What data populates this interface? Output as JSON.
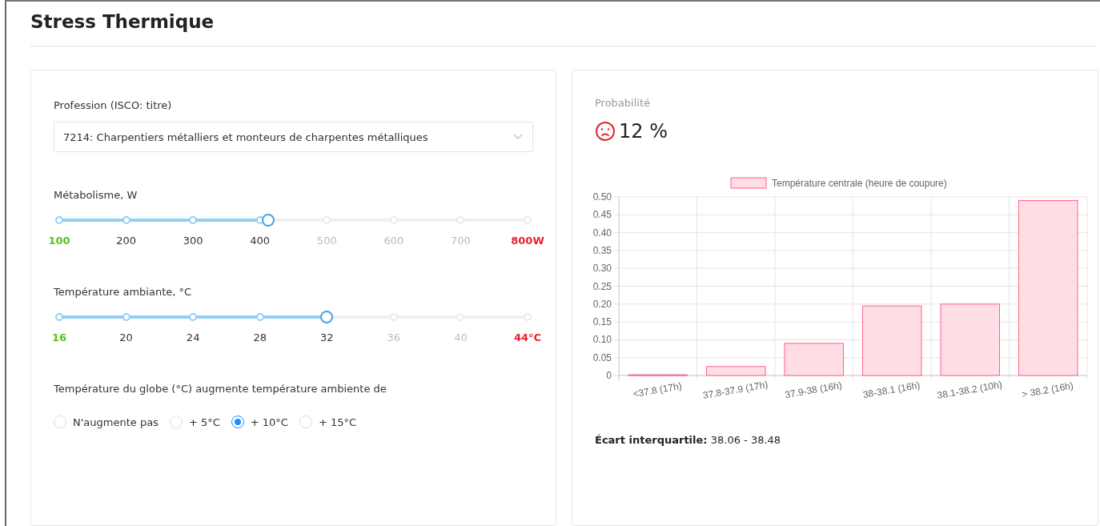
{
  "page": {
    "title": "Stress Thermique"
  },
  "form": {
    "profession": {
      "label": "Profession (ISCO: titre)",
      "value": "7214: Charpentiers métalliers et monteurs de charpentes métalliques"
    },
    "sliders": [
      {
        "label": "Métabolisme, W",
        "level": 0.446,
        "ticks": [
          {
            "label": "100",
            "kind": "min"
          },
          {
            "label": "200",
            "kind": "mid"
          },
          {
            "label": "300",
            "kind": "mid"
          },
          {
            "label": "400",
            "kind": "mid"
          },
          {
            "label": "500",
            "kind": "mid"
          },
          {
            "label": "600",
            "kind": "mid"
          },
          {
            "label": "700",
            "kind": "mid"
          },
          {
            "label": "800W",
            "kind": "max"
          }
        ]
      },
      {
        "label": "Température ambiante, °C",
        "level": 0.571,
        "ticks": [
          {
            "label": "16",
            "kind": "min"
          },
          {
            "label": "20",
            "kind": "mid"
          },
          {
            "label": "24",
            "kind": "mid"
          },
          {
            "label": "28",
            "kind": "mid"
          },
          {
            "label": "32",
            "kind": "mid"
          },
          {
            "label": "36",
            "kind": "mid"
          },
          {
            "label": "40",
            "kind": "mid"
          },
          {
            "label": "44°C",
            "kind": "max"
          }
        ]
      }
    ],
    "globe": {
      "label": "Température du globe (°C) augmente température ambiente de",
      "options": [
        {
          "label": "N'augmente pas",
          "selected": false
        },
        {
          "label": "+ 5°C",
          "selected": false
        },
        {
          "label": "+ 10°C",
          "selected": true
        },
        {
          "label": "+ 15°C",
          "selected": false
        }
      ]
    }
  },
  "result": {
    "caption": "Probabilité",
    "value": "12 %",
    "chart_data": {
      "type": "bar",
      "categories": [
        "<37.8 (17h)",
        "37.8-37.9 (17h)",
        "37.9-38 (16h)",
        "38-38.1 (16h)",
        "38.1-38.2 (10h)",
        "> 38.2 (16h)"
      ],
      "series": [
        {
          "name": "Température centrale (heure de coupure)",
          "color": "#ff6384",
          "values": [
            0.002,
            0.025,
            0.09,
            0.195,
            0.2,
            0.49
          ]
        }
      ],
      "ylim": [
        0,
        0.5
      ],
      "grid": true,
      "yticks": [
        {
          "value": 0,
          "label": "0"
        },
        {
          "value": 0.05,
          "label": "0.05"
        },
        {
          "value": 0.1,
          "label": "0.10"
        },
        {
          "value": 0.15,
          "label": "0.15"
        },
        {
          "value": 0.2,
          "label": "0.20"
        },
        {
          "value": 0.25,
          "label": "0.25"
        },
        {
          "value": 0.3,
          "label": "0.30"
        },
        {
          "value": 0.35,
          "label": "0.35"
        },
        {
          "value": 0.4,
          "label": "0.40"
        },
        {
          "value": 0.45,
          "label": "0.45"
        },
        {
          "value": 0.5,
          "label": "0.50"
        }
      ]
    },
    "iqr": {
      "label": "Écart interquartile:",
      "value": "38.06 - 38.48"
    }
  }
}
